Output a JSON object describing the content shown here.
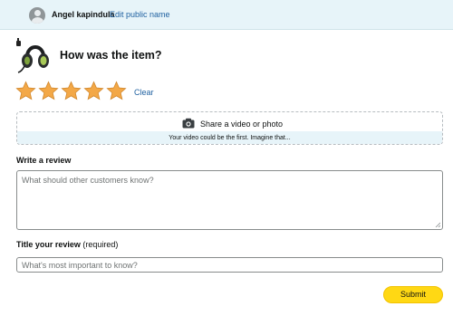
{
  "header": {
    "username": "Angel kapindula",
    "edit_link": "Edit public name",
    "avatar_icon": "user-avatar-icon"
  },
  "review": {
    "title": "How was the item?",
    "product_image_icon": "headset-icon",
    "rating": {
      "value": 5,
      "max": 5,
      "color": "#f3a847"
    },
    "clear_label": "Clear"
  },
  "media": {
    "label": "Share a video or photo",
    "hint": "Your video could be the first. Imagine that...",
    "icon": "camera-icon"
  },
  "written_review": {
    "label": "Write a review",
    "placeholder": "What should other customers know?"
  },
  "review_title": {
    "label": "Title your review",
    "required_note": "(required)",
    "placeholder": "What's most important to know?"
  },
  "actions": {
    "submit_label": "Submit"
  },
  "colors": {
    "accent": "#ffd814",
    "link": "#2162a1",
    "banner": "#e7f4f9"
  }
}
